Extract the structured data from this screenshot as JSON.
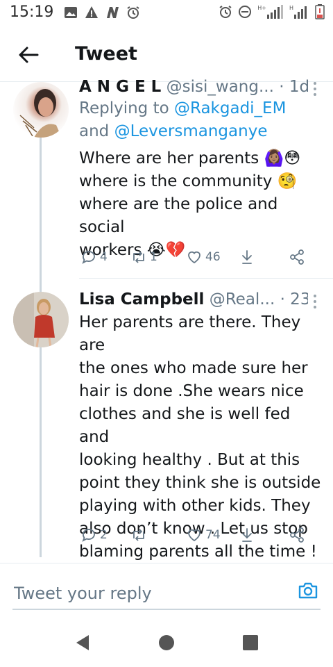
{
  "status_bar": {
    "time": "15:19",
    "left_icons": [
      "image-icon",
      "warning-icon",
      "n-icon",
      "alarm-icon"
    ],
    "right_icons": [
      "alarm-icon",
      "dnd-icon",
      "signal-h-plus-icon",
      "signal-h-icon",
      "battery-low-icon"
    ],
    "signal_label_1": "H+",
    "signal_label_2": "H"
  },
  "header": {
    "title": "Tweet"
  },
  "tweets": [
    {
      "name": "A N G E L",
      "handle": "@sisi_wang...",
      "time": "· 1d",
      "replying_prefix": "Replying to",
      "mention1": "@Rakgadi_EM",
      "and_text": "and",
      "mention2": "@Leversmanganye",
      "lines": [
        "Where are her parents 🙆🏽‍♀️😳",
        "where is the community 🧐",
        "where are the police and social",
        "workers 😭💔"
      ],
      "replies": "4",
      "retweets": "1",
      "likes": "46"
    },
    {
      "name": "Lisa Campbell",
      "handle": "@Real...",
      "time": "· 23h",
      "lines": [
        "Her parents are there. They are",
        "the ones who made sure her",
        "hair is done .She wears nice",
        "clothes and she is well fed and",
        "looking healthy . But at this",
        "point they think she is outside",
        "playing with other kids. They",
        "also don’t know . Let us stop",
        "blaming parents all the time !"
      ],
      "replies": "2",
      "retweets": "",
      "likes": "74"
    }
  ],
  "reply_bar": {
    "placeholder": "Tweet your reply"
  },
  "colors": {
    "accent": "#1b95e0",
    "muted": "#657786",
    "text": "#14171a",
    "line": "#ccd6dd"
  }
}
